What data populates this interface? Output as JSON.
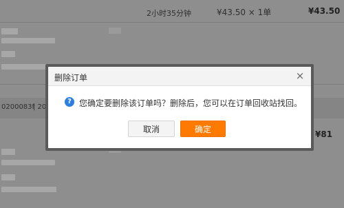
{
  "background": {
    "top_row": {
      "time_left": "2小时35分钟",
      "unit_price_qty": "¥43.50 × 1单",
      "total": "¥43.50"
    },
    "order2": {
      "order_no_fragment": "0200083f",
      "separator_text": "| 20",
      "total": "¥81"
    }
  },
  "dialog": {
    "title": "删除订单",
    "close_glyph": "×",
    "help_glyph": "?",
    "message": "您确定要删除该订单吗？删除后，您可以在订单回收站找回。",
    "cancel_label": "取消",
    "confirm_label": "确定"
  },
  "colors": {
    "accent": "#ff7a00",
    "question_icon": "#2b7fe0"
  }
}
